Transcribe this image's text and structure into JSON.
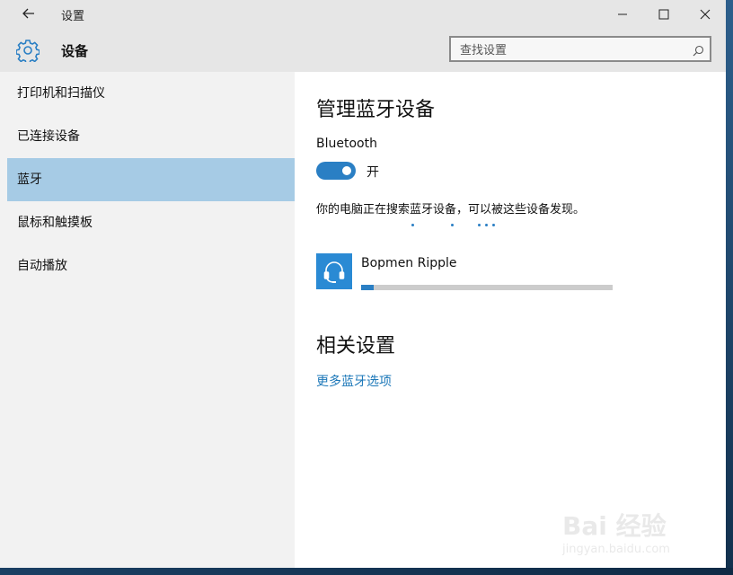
{
  "window": {
    "title": "设置",
    "back_icon": "back-arrow-icon"
  },
  "header": {
    "title": "设备",
    "icon": "gear-icon",
    "search_placeholder": "查找设置"
  },
  "sidebar": {
    "items": [
      {
        "label": "打印机和扫描仪",
        "selected": false
      },
      {
        "label": "已连接设备",
        "selected": false
      },
      {
        "label": "蓝牙",
        "selected": true
      },
      {
        "label": "鼠标和触摸板",
        "selected": false
      },
      {
        "label": "自动播放",
        "selected": false
      }
    ]
  },
  "main": {
    "heading": "管理蓝牙设备",
    "bluetooth_label": "Bluetooth",
    "toggle_state": "开",
    "toggle_on": true,
    "searching_text": "你的电脑正在搜索蓝牙设备，可以被这些设备发现。",
    "device": {
      "name": "Bopmen Ripple",
      "icon": "headset-icon",
      "progress": 0.05
    },
    "related_heading": "相关设置",
    "more_link": "更多蓝牙选项"
  },
  "watermark": {
    "brand": "Bai 经验",
    "url": "jingyan.baidu.com"
  },
  "colors": {
    "accent": "#2a7fc4",
    "selected_nav": "#a6cbe5",
    "link": "#1b77b8"
  }
}
